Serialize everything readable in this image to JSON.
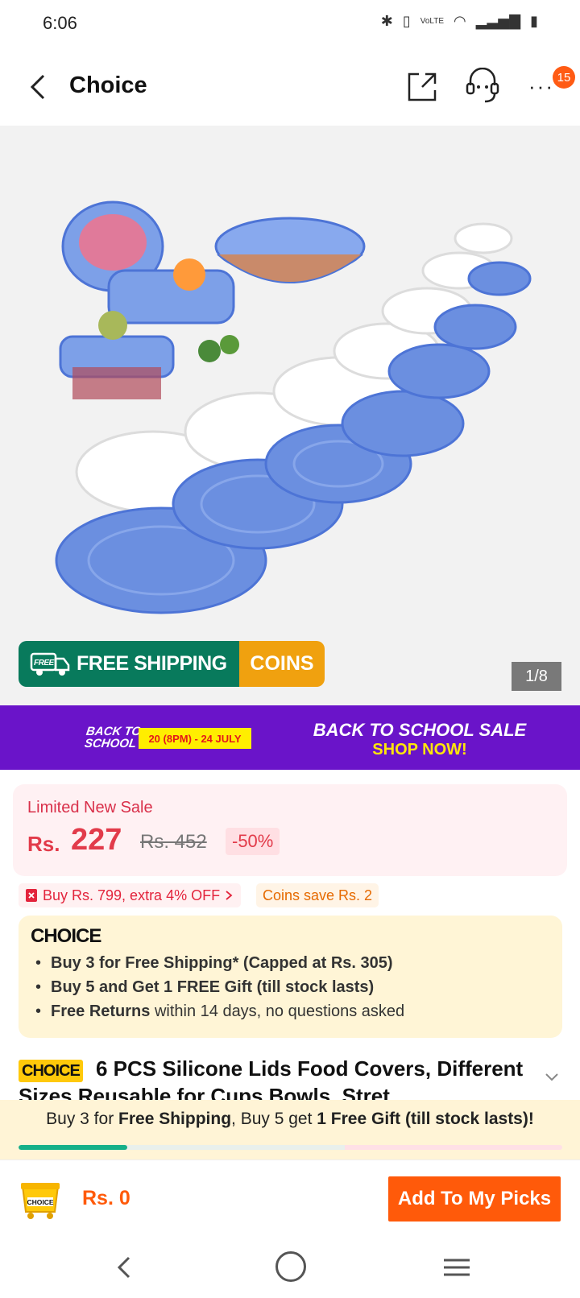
{
  "status_bar": {
    "time": "6:06",
    "network": "VoLTE"
  },
  "header": {
    "title": "Choice",
    "badge_count": "15"
  },
  "gallery": {
    "counter": "1/8",
    "shipping_banner": {
      "free_tag": "FREE",
      "label": "FREE SHIPPING",
      "coins": "COINS"
    }
  },
  "promo": {
    "logo_line1": "BACK TO",
    "logo_line2": "SCHOOL",
    "dates": "20 (8PM) - 24 JULY",
    "title": "BACK TO SCHOOL SALE",
    "cta": "SHOP NOW!"
  },
  "price": {
    "sale_label": "Limited New Sale",
    "currency": "Rs.",
    "current": "227",
    "original": "Rs. 452",
    "discount": "-50%"
  },
  "coupons": {
    "offer": "Buy Rs. 799, extra 4% OFF",
    "coins": "Coins save Rs. 2"
  },
  "choice": {
    "logo": "CHOICE",
    "benefits": [
      {
        "bold": "Buy 3 for  Free Shipping* (Capped at Rs. 305)",
        "rest": ""
      },
      {
        "bold": "Buy 5 and Get 1 FREE Gift (till stock lasts)",
        "rest": ""
      },
      {
        "bold": "Free Returns",
        "rest": " within 14 days, no questions asked"
      }
    ]
  },
  "product": {
    "badge": "CHOICE",
    "title": "6 PCS Silicone Lids Food Covers, Different Sizes Reusable for Cups Bowls, Stret..."
  },
  "progress": {
    "t1": "Buy 3 for ",
    "b1": "Free Shipping",
    "t2": ", Buy 5 get ",
    "b2": "1 Free Gift (till stock lasts)!",
    "fill_fraction": 0.2
  },
  "bottom": {
    "cart_label": "CHOICE",
    "total": "Rs. 0",
    "add_button": "Add To My Picks"
  },
  "colors": {
    "accent": "#ff5a0a",
    "price_red": "#e23b4a",
    "shipping_green": "#087a5c",
    "coins_orange": "#f0a10f",
    "promo_purple": "#6a14c9",
    "choice_yellow": "#ffc90a"
  }
}
